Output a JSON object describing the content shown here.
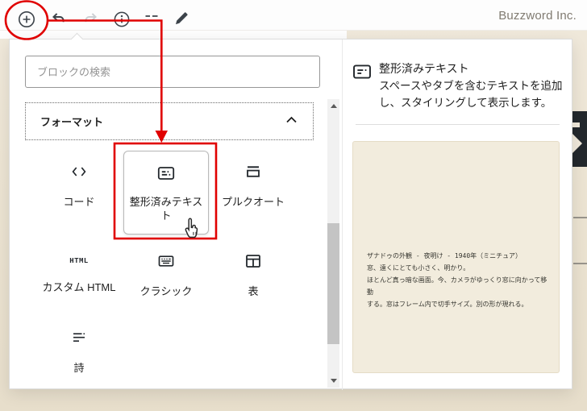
{
  "colors": {
    "annotation_red": "#e00000",
    "page_background": "#ece4d3",
    "preview_background": "#f2ecdd",
    "text_dark": "#1e1e1e",
    "toolbar_icon_gray": "#3c434a",
    "disabled_icon_gray": "#ccd0d4",
    "scrollbar_thumb": "#c4c4c4"
  },
  "header": {
    "brand": "Buzzword Inc.",
    "toolbar_icons": [
      "inserter-toggle-icon",
      "undo-icon",
      "redo-icon",
      "details-icon",
      "list-view-icon",
      "edit-icon"
    ]
  },
  "inserter": {
    "search_placeholder": "ブロックの検索",
    "section_title": "フォーマット",
    "section_chevron": "chevron-up-icon",
    "html_icon_text": "HTML",
    "blocks": [
      {
        "label": "コード",
        "icon": "code-icon"
      },
      {
        "label": "整形済みテキスト",
        "icon": "preformatted-icon",
        "state": "hovered-with-cursor"
      },
      {
        "label": "プルクオート",
        "icon": "pullquote-icon"
      },
      {
        "label": "カスタム HTML",
        "icon": "html-icon"
      },
      {
        "label": "クラシック",
        "icon": "classic-icon"
      },
      {
        "label": "表",
        "icon": "table-icon"
      },
      {
        "label": "詩",
        "icon": "verse-icon"
      }
    ]
  },
  "preview_panel": {
    "icon": "preformatted-icon",
    "title": "整形済みテキスト",
    "description": "スペースやタブを含むテキストを追加し、スタイリングして表示します。",
    "preview_lines": [
      "ザナドゥの外観 - 夜明け - 1940年（ミニチュア）",
      "窓、遠くにとても小さく、明かり。",
      "ほとんど真っ暗な画面。今、カメラがゆっくり窓に向かって移動",
      "する。窓はフレーム内で切手サイズ。別の形が現れる。"
    ]
  },
  "annotation": {
    "color": "#e00000",
    "shapes": [
      "circle-around-inserter-button",
      "arrow-to-preformatted-block",
      "box-around-preformatted-block"
    ],
    "cursor": "hand-cursor-icon"
  }
}
